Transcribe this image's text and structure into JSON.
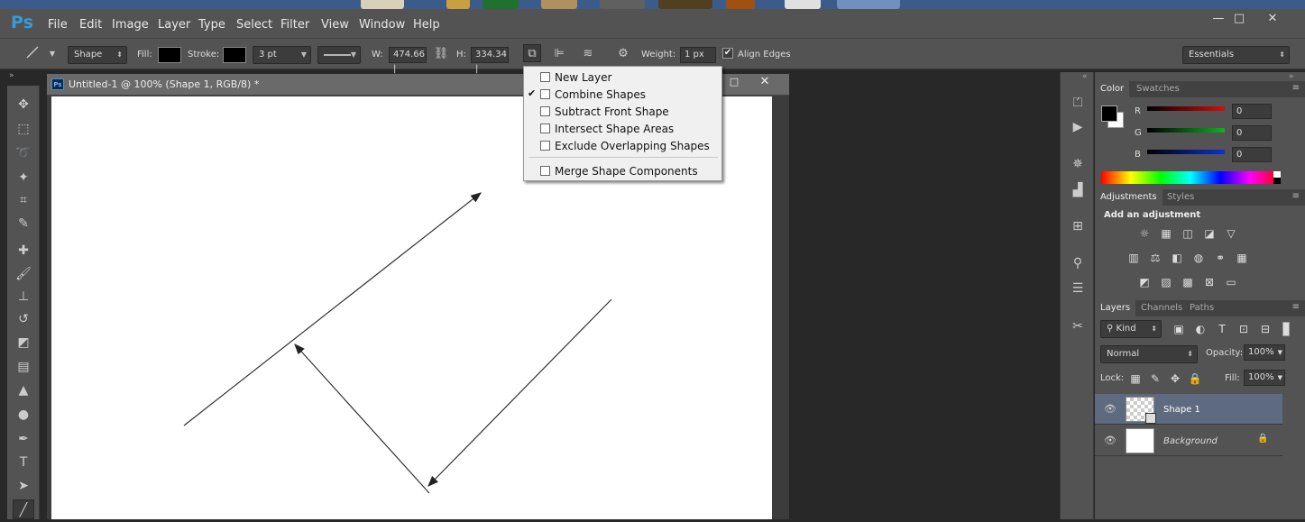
{
  "menubar": {
    "logo": "Ps",
    "items": [
      "File",
      "Edit",
      "Image",
      "Layer",
      "Type",
      "Select",
      "Filter",
      "View",
      "Window",
      "Help"
    ]
  },
  "window_controls": {
    "minimize": "—",
    "maximize": "□",
    "close": "✕"
  },
  "options": {
    "mode": "Shape",
    "fill_label": "Fill:",
    "stroke_label": "Stroke:",
    "stroke_width": "3 pt",
    "w_label": "W:",
    "w_value": "474.66 |",
    "h_label": "H:",
    "h_value": "334.34 |",
    "weight_label": "Weight:",
    "weight_value": "1 px",
    "align_edges": "Align Edges",
    "workspace": "Essentials"
  },
  "document": {
    "title": "Untitled-1 @ 100% (Shape 1, RGB/8) *",
    "icon": "Ps"
  },
  "path_ops_menu": {
    "items": [
      {
        "label": "New Layer",
        "checked": false
      },
      {
        "label": "Combine Shapes",
        "checked": true
      },
      {
        "label": "Subtract Front Shape",
        "checked": false
      },
      {
        "label": "Intersect Shape Areas",
        "checked": false
      },
      {
        "label": "Exclude Overlapping Shapes",
        "checked": false
      }
    ],
    "merge": "Merge Shape Components",
    "check_mark": "✔"
  },
  "color_panel": {
    "tabs": [
      "Color",
      "Swatches"
    ],
    "channels": [
      {
        "label": "R",
        "value": "0",
        "color": "#d01010"
      },
      {
        "label": "G",
        "value": "0",
        "color": "#10b020"
      },
      {
        "label": "B",
        "value": "0",
        "color": "#1030d0"
      }
    ]
  },
  "adjustments_panel": {
    "tabs": [
      "Adjustments",
      "Styles"
    ],
    "heading": "Add an adjustment"
  },
  "layers_panel": {
    "tabs": [
      "Layers",
      "Channels",
      "Paths"
    ],
    "kind": "Kind",
    "blend_mode": "Normal",
    "opacity_label": "Opacity:",
    "opacity_value": "100%",
    "lock_label": "Lock:",
    "fill_label": "Fill:",
    "fill_value": "100%",
    "layers": [
      {
        "name": "Shape 1",
        "selected": true
      },
      {
        "name": "Background",
        "selected": false
      }
    ]
  }
}
